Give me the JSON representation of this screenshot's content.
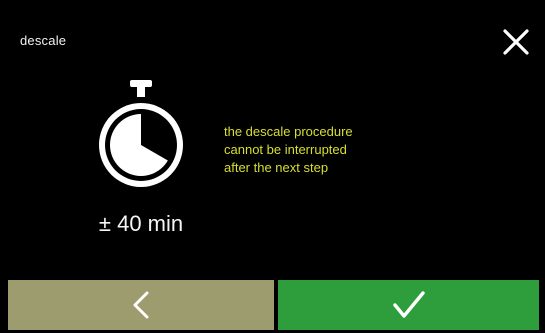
{
  "header": {
    "title": "descale",
    "close_icon": "close-icon"
  },
  "main": {
    "timer_icon": "stopwatch-icon",
    "duration": "± 40 min",
    "warning_lines": [
      "the descale procedure",
      "cannot be interrupted",
      "after the next step"
    ],
    "warning_color": "#d8df2e"
  },
  "footer": {
    "back_icon": "chevron-left-icon",
    "back_color": "#9c9c6e",
    "confirm_icon": "checkmark-icon",
    "confirm_color": "#2e9e3c"
  }
}
